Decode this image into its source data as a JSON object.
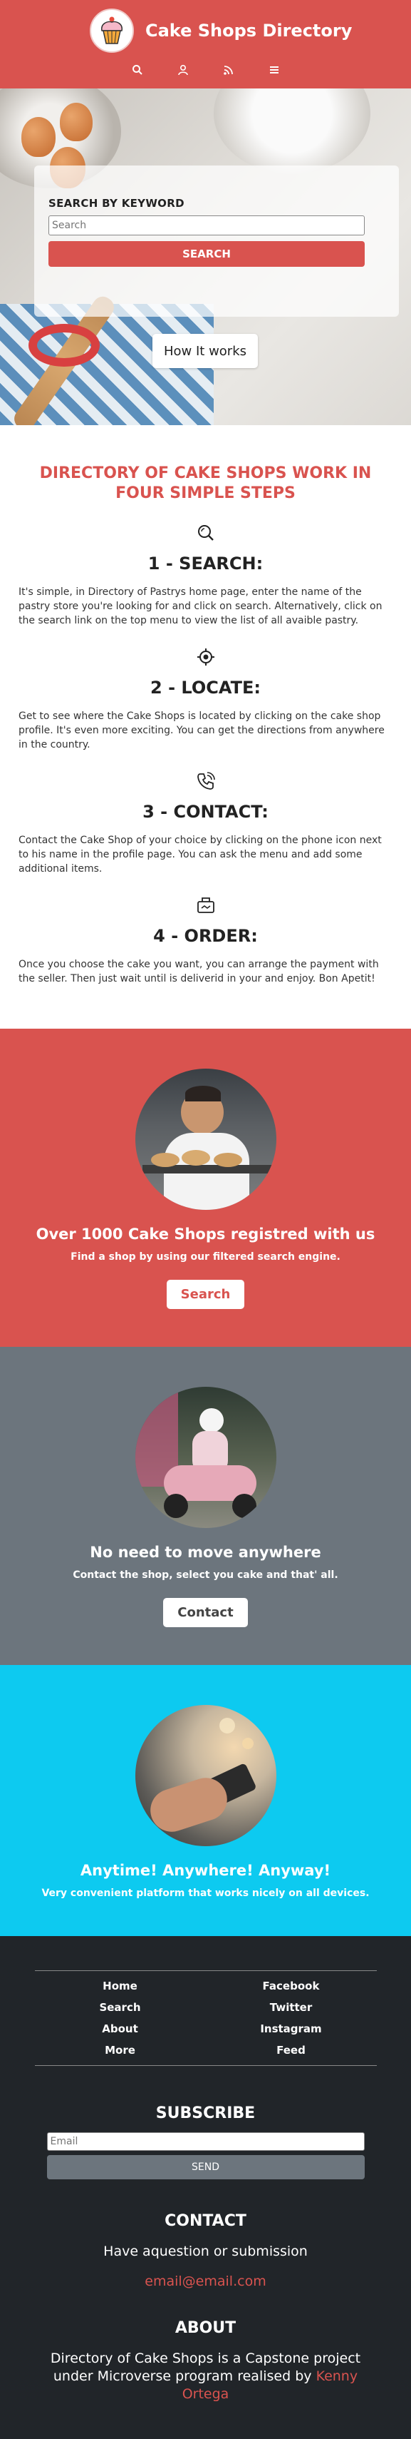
{
  "header": {
    "title": "Cake Shops Directory",
    "nav_icons": [
      "search-icon",
      "user-icon",
      "rss-icon",
      "menu-icon"
    ]
  },
  "hero": {
    "search_label": "SEARCH BY KEYWORD",
    "search_placeholder": "Search",
    "search_button": "SEARCH",
    "how_button": "How It works"
  },
  "steps": {
    "title": "DIRECTORY OF CAKE SHOPS WORK IN FOUR SIMPLE STEPS",
    "items": [
      {
        "icon": "search-icon",
        "heading": "1 - SEARCH:",
        "text": "It's simple, in Directory of Pastrys home page, enter the name of the pastry store you're looking for and click on search. Alternatively, click on the search link on the top menu to view the list of all avaible pastry."
      },
      {
        "icon": "locate-icon",
        "heading": "2 - LOCATE:",
        "text": "Get to see where the Cake Shops is located by clicking on the cake shop profile. It's even more exciting. You can get the directions from anywhere in the country."
      },
      {
        "icon": "phone-icon",
        "heading": "3 - CONTACT:",
        "text": "Contact the Cake Shop of your choice by clicking on the phone icon next to his name in the profile page. You can ask the menu and add some additional items."
      },
      {
        "icon": "box-icon",
        "heading": "4 - ORDER:",
        "text": "Once you choose the cake you want, you can arrange the payment with the seller. Then just wait until is deliverid in your and enjoy. Bon Apetit!"
      }
    ]
  },
  "promo_search": {
    "heading": "Over 1000 Cake Shops registred with us",
    "text": "Find a shop by using our filtered search engine.",
    "button": "Search",
    "color": "#d9534f"
  },
  "promo_contact": {
    "heading": "No need to move anywhere",
    "text": "Contact the shop, select you cake and that' all.",
    "button": "Contact",
    "color": "#6c757d"
  },
  "promo_anytime": {
    "heading": "Anytime! Anywhere! Anyway!",
    "text": "Very convenient platform that works nicely on all devices.",
    "color": "#0dcaf0"
  },
  "footer": {
    "links": [
      "Home",
      "Facebook",
      "Search",
      "Twitter",
      "About",
      "Instagram",
      "More",
      "Feed"
    ],
    "subscribe_title": "SUBSCRIBE",
    "email_placeholder": "Email",
    "send_button": "SEND",
    "contact_title": "CONTACT",
    "contact_text": "Have aquestion or submission",
    "contact_email": "email@email.com",
    "about_title": "ABOUT",
    "about_text": "Directory of Cake Shops is a Capstone project under Microverse program realised by",
    "about_author": "Kenny Ortega"
  }
}
